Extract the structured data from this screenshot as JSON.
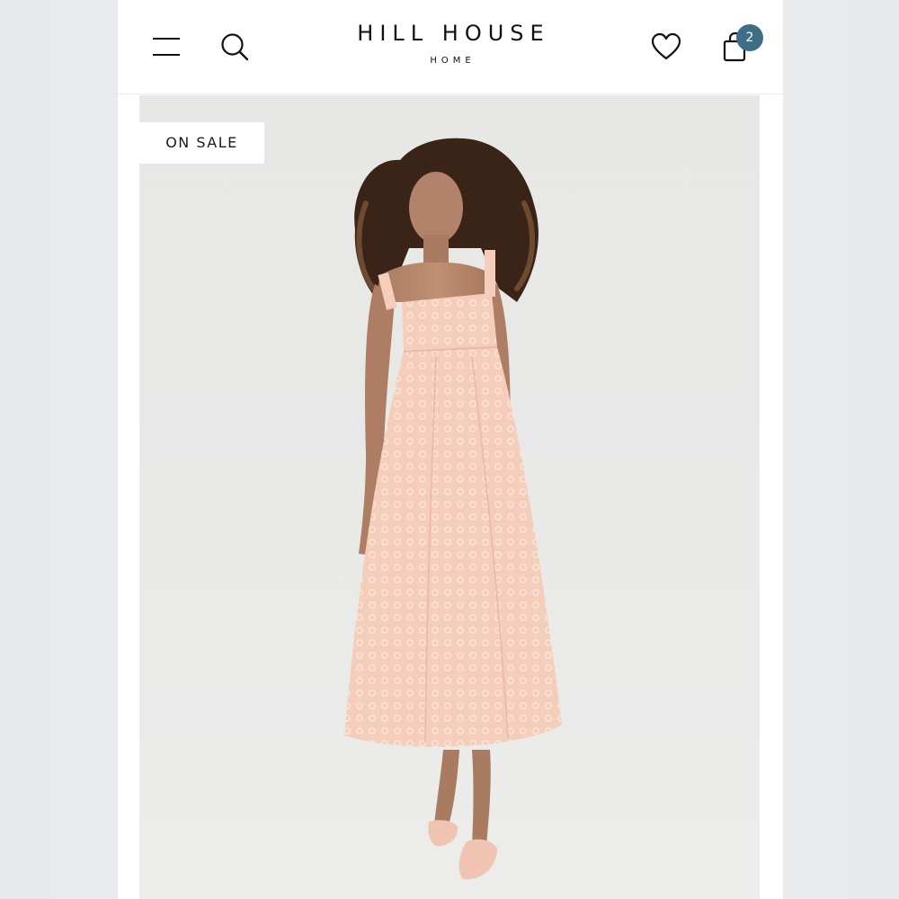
{
  "header": {
    "brand": "HILL HOUSE",
    "brand_sub": "HOME",
    "menu_icon": "hamburger-menu-icon",
    "search_icon": "search-icon",
    "wishlist_icon": "heart-icon",
    "cart_icon": "shopping-bag-icon",
    "cart_count": "2"
  },
  "product": {
    "badge": "ON SALE",
    "image": "model-in-pink-midi-dress"
  },
  "colors": {
    "badge_accent": "#3f6d86",
    "dress": "#f3c9b6",
    "background": "#e8e8e7"
  }
}
